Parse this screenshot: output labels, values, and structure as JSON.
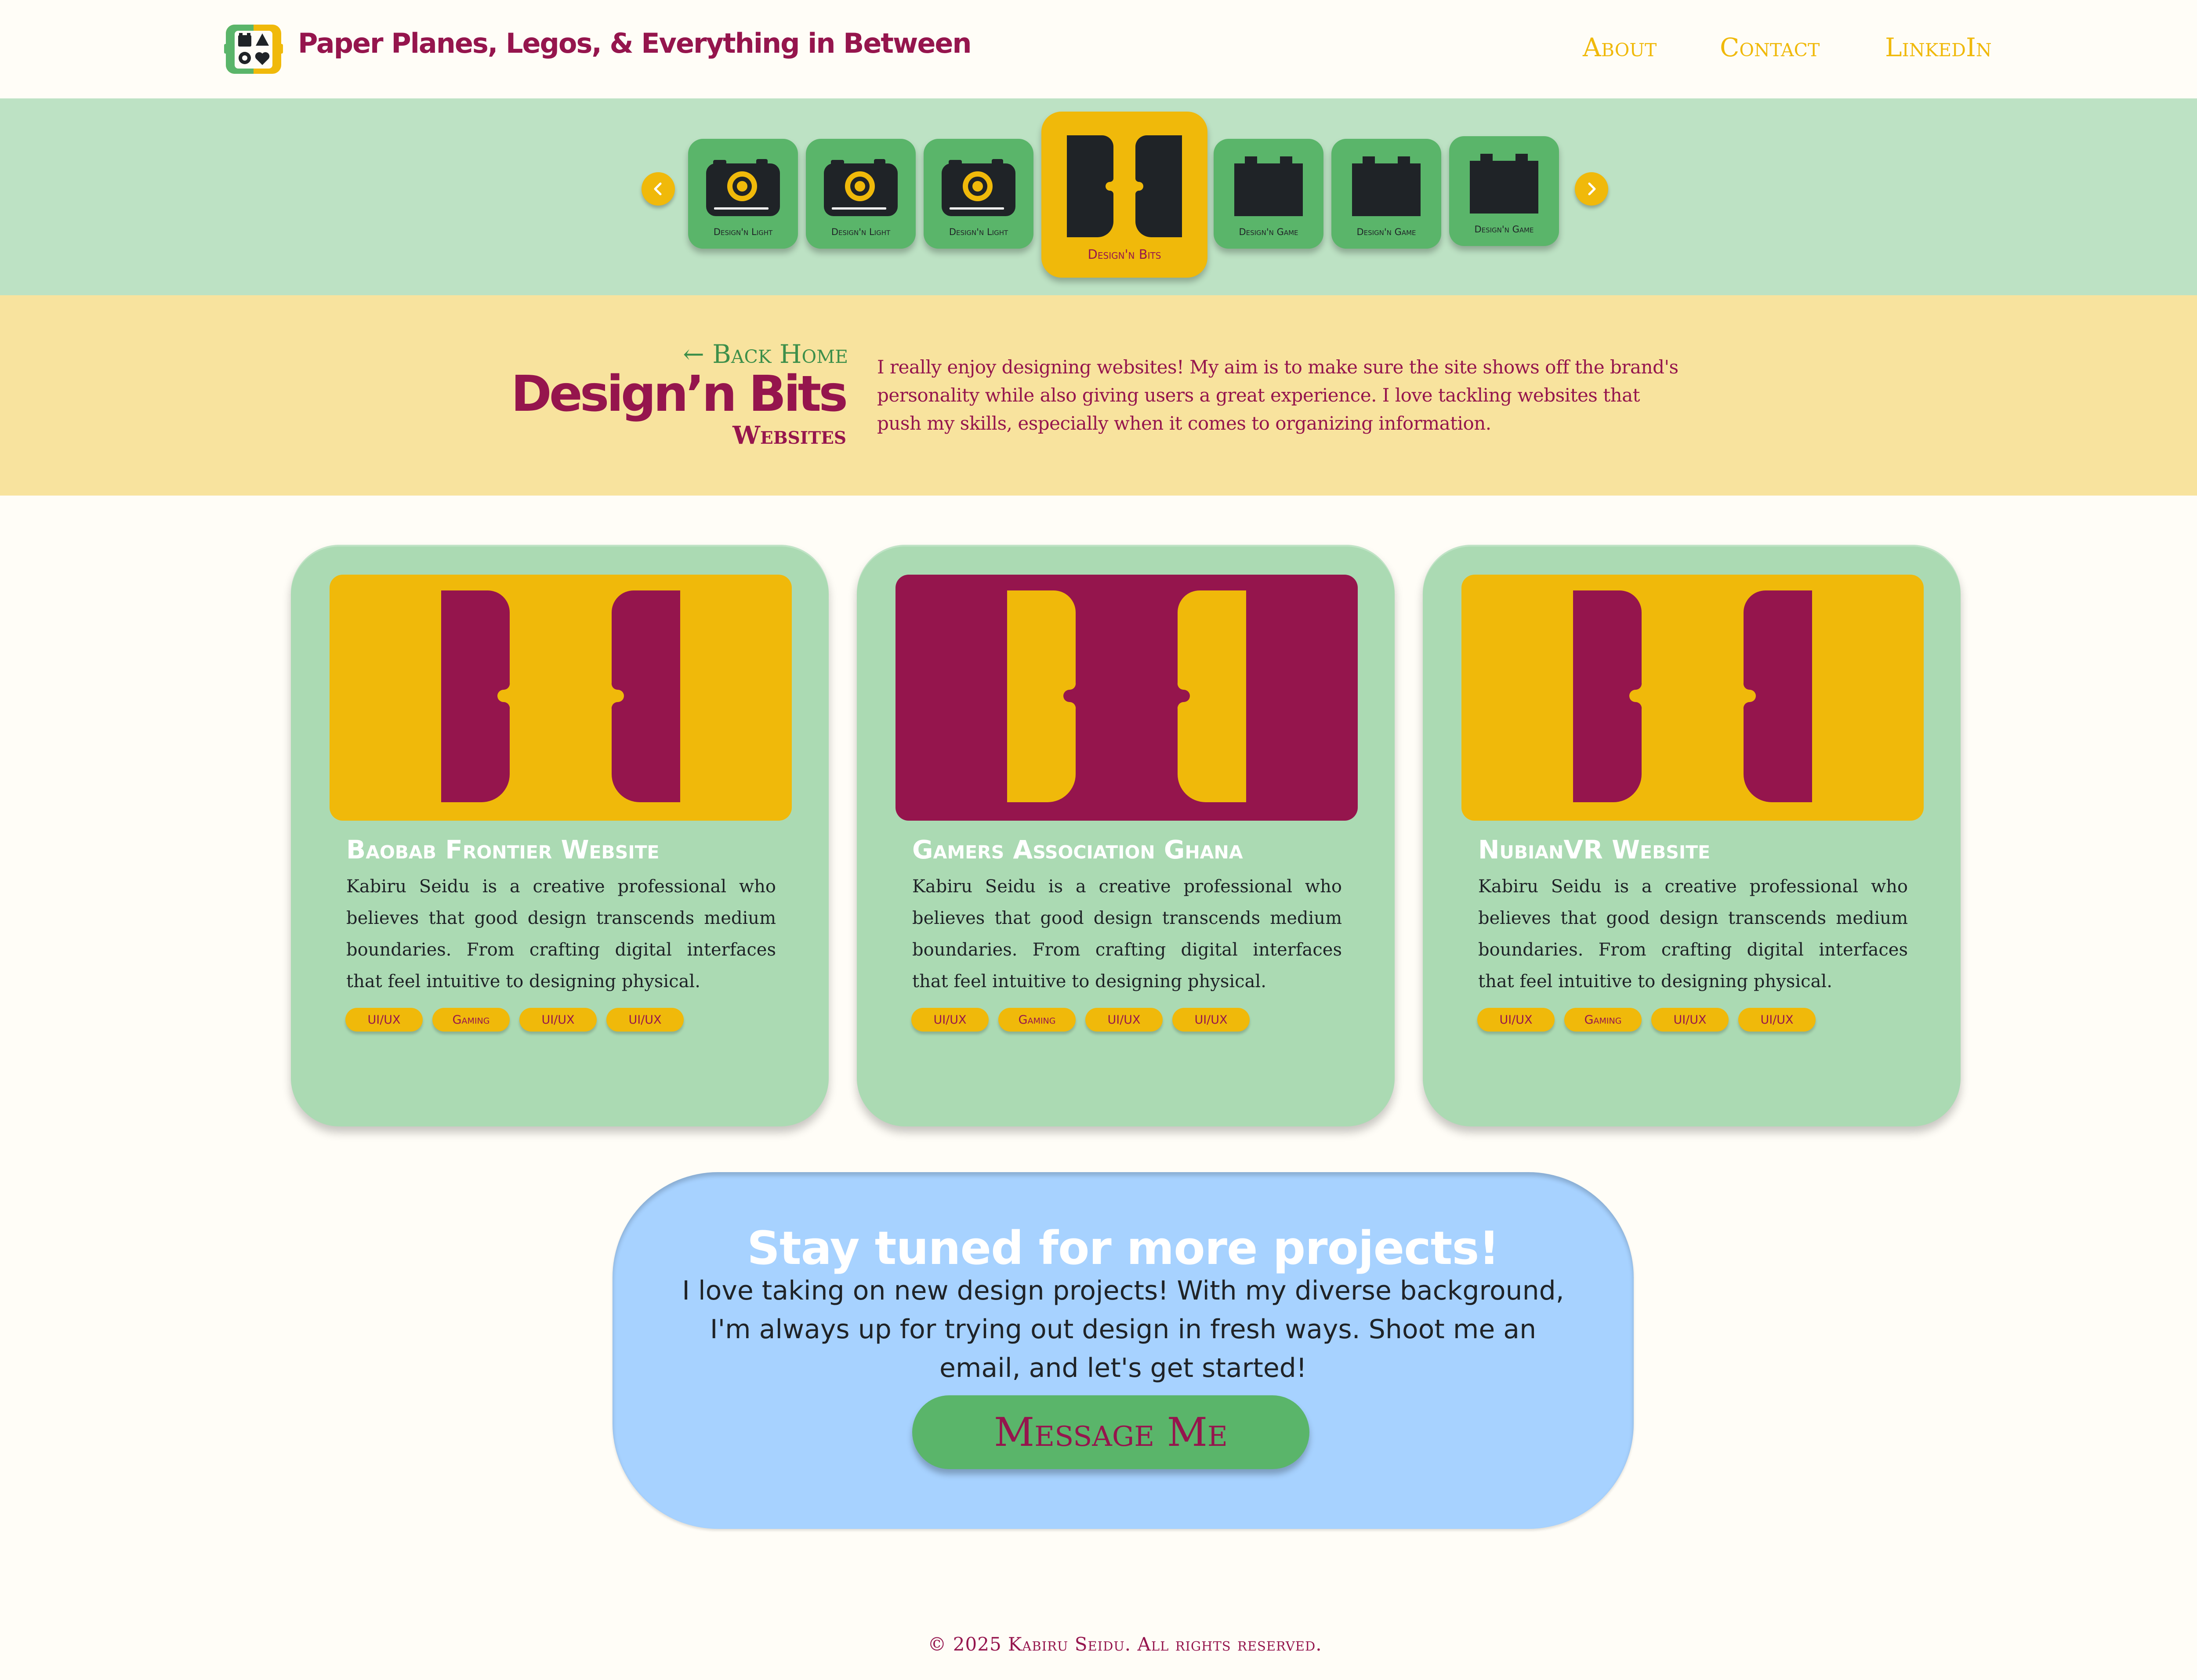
{
  "header": {
    "site_title": "Paper Planes, Legos, & Everything in Between",
    "nav": [
      {
        "label": "About"
      },
      {
        "label": "Contact"
      },
      {
        "label": "LinkedIn"
      }
    ]
  },
  "carousel": {
    "items": [
      {
        "label": "Design'n Light",
        "icon": "camera-icon"
      },
      {
        "label": "Design'n Light",
        "icon": "camera-icon"
      },
      {
        "label": "Design'n Light",
        "icon": "camera-icon"
      },
      {
        "label": "Design'n Bits",
        "icon": "bits-logo-icon",
        "active": true
      },
      {
        "label": "Design'n Game",
        "icon": "lego-brick-icon"
      },
      {
        "label": "Design'n Game",
        "icon": "lego-brick-icon"
      },
      {
        "label": "Design'n Game",
        "icon": "lego-brick-icon"
      }
    ]
  },
  "intro": {
    "back_link": "← Back Home",
    "title": "Design’n Bits",
    "subtitle": "Websites",
    "description": "I really enjoy designing websites! My aim is to make sure the site shows off the brand's personality while also giving users a great experience. I love tackling websites that push my skills, especially when it comes to organizing information."
  },
  "projects": [
    {
      "title": "Baobab Frontier Website",
      "description": "Kabiru Seidu is a creative professional who believes that good design transcends medium boundaries. From crafting digital interfaces that feel intuitive to designing physical.",
      "tags": [
        "UI/UX",
        "Gaming",
        "UI/UX",
        "UI/UX"
      ],
      "banner_bg": "#f0b90a",
      "banner_fg": "#95154d"
    },
    {
      "title": "Gamers Association Ghana",
      "description": "Kabiru Seidu is a creative professional who believes that good design transcends medium boundaries. From crafting digital interfaces that feel intuitive to designing physical.",
      "tags": [
        "UI/UX",
        "Gaming",
        "UI/UX",
        "UI/UX"
      ],
      "banner_bg": "#95154d",
      "banner_fg": "#f0b90a"
    },
    {
      "title": "NubianVR Website",
      "description": "Kabiru Seidu is a creative professional who believes that good design transcends medium boundaries. From crafting digital interfaces that feel intuitive to designing physical.",
      "tags": [
        "UI/UX",
        "Gaming",
        "UI/UX",
        "UI/UX"
      ],
      "banner_bg": "#f0b90a",
      "banner_fg": "#95154d"
    }
  ],
  "cta": {
    "title": "Stay tuned for more projects!",
    "text": "I love taking on new design projects! With my diverse background, I'm always up for trying out design in fresh ways. Shoot me an email, and let's get started!",
    "button_label": "Message Me"
  },
  "footer": {
    "copyright": "© 2025 Kabiru Seidu. All rights reserved."
  },
  "colors": {
    "background": "#fffdf7",
    "carousel_band": "#bde2c4",
    "intro_band": "#f8e39e",
    "card": "#abdab3",
    "green": "#5ab56a",
    "gold": "#f0b90a",
    "maroon": "#95154d",
    "cta": "#a7d2ff"
  }
}
